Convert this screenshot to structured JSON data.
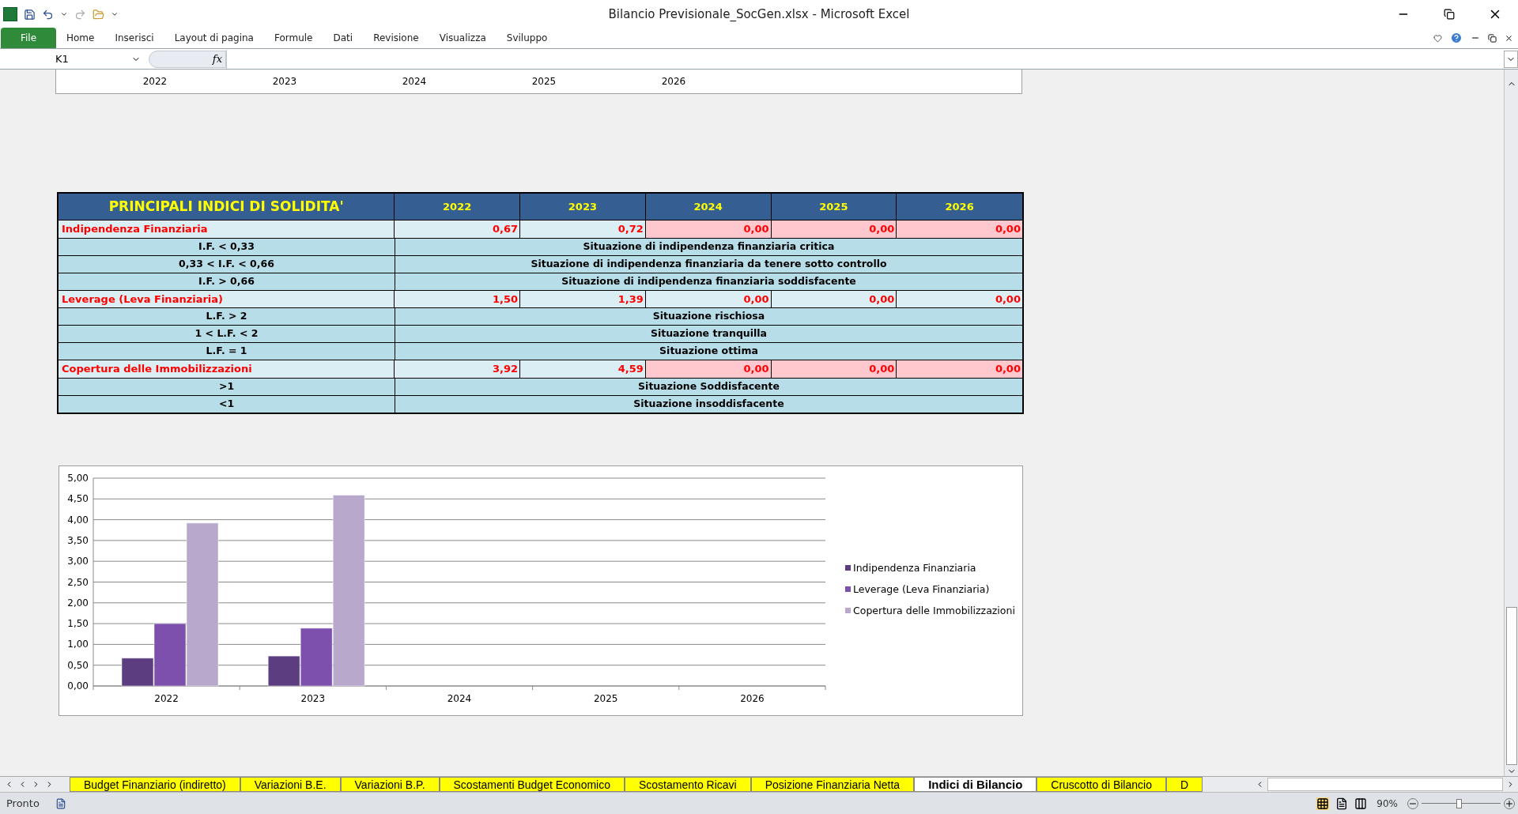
{
  "window": {
    "title": "Bilancio Previsionale_SocGen.xlsx  -  Microsoft Excel"
  },
  "ribbon": {
    "file_tab": "File",
    "tabs": [
      "Home",
      "Inserisci",
      "Layout di pagina",
      "Formule",
      "Dati",
      "Revisione",
      "Visualizza",
      "Sviluppo"
    ]
  },
  "formula_bar": {
    "name_box": "K1",
    "function_button": "fx"
  },
  "upper_chart_axis_labels": [
    "2022",
    "2023",
    "2024",
    "2025",
    "2026"
  ],
  "table": {
    "title": "PRINCIPALI INDICI DI SOLIDITA'",
    "years": [
      "2022",
      "2023",
      "2024",
      "2025",
      "2026"
    ],
    "rows": [
      {
        "kind": "indicator",
        "label": "Indipendenza Finanziaria",
        "values": [
          {
            "text": "0,67",
            "highlighted": false
          },
          {
            "text": "0,72",
            "highlighted": false
          },
          {
            "text": "0,00",
            "highlighted": true
          },
          {
            "text": "0,00",
            "highlighted": true
          },
          {
            "text": "0,00",
            "highlighted": true
          }
        ]
      },
      {
        "kind": "threshold",
        "label": "I.F. < 0,33",
        "description": "Situazione di indipendenza finanziaria critica"
      },
      {
        "kind": "threshold",
        "label": "0,33 < I.F. < 0,66",
        "description": "Situazione di indipendenza finanziaria da tenere sotto controllo"
      },
      {
        "kind": "threshold",
        "label": "I.F. > 0,66",
        "description": "Situazione di indipendenza finanziaria soddisfacente"
      },
      {
        "kind": "indicator",
        "label": "Leverage (Leva Finanziaria)",
        "values": [
          {
            "text": "1,50",
            "highlighted": false
          },
          {
            "text": "1,39",
            "highlighted": false
          },
          {
            "text": "0,00",
            "highlighted": false
          },
          {
            "text": "0,00",
            "highlighted": false
          },
          {
            "text": "0,00",
            "highlighted": false
          }
        ]
      },
      {
        "kind": "threshold",
        "label": "L.F. > 2",
        "description": "Situazione rischiosa"
      },
      {
        "kind": "threshold",
        "label": "1 < L.F. < 2",
        "description": "Situazione tranquilla"
      },
      {
        "kind": "threshold",
        "label": "L.F. = 1",
        "description": "Situazione ottima"
      },
      {
        "kind": "indicator",
        "label": "Copertura delle Immobilizzazioni",
        "values": [
          {
            "text": "3,92",
            "highlighted": false
          },
          {
            "text": "4,59",
            "highlighted": false
          },
          {
            "text": "0,00",
            "highlighted": true
          },
          {
            "text": "0,00",
            "highlighted": true
          },
          {
            "text": "0,00",
            "highlighted": true
          }
        ]
      },
      {
        "kind": "threshold",
        "label": ">1",
        "description": "Situazione Soddisfacente"
      },
      {
        "kind": "threshold",
        "label": "<1",
        "description": "Situazione insoddisfacente"
      }
    ]
  },
  "chart": {
    "chart_data": {
      "type": "bar",
      "categories": [
        "2022",
        "2023",
        "2024",
        "2025",
        "2026"
      ],
      "series": [
        {
          "name": "Indipendenza Finanziaria",
          "color": "#5b3d80",
          "values": [
            0.67,
            0.72,
            0,
            0,
            0
          ]
        },
        {
          "name": "Leverage (Leva Finanziaria)",
          "color": "#7c50ac",
          "values": [
            1.5,
            1.39,
            0,
            0,
            0
          ]
        },
        {
          "name": "Copertura delle Immobilizzazioni",
          "color": "#b7a8cc",
          "values": [
            3.92,
            4.59,
            0,
            0,
            0
          ]
        }
      ],
      "ylim": [
        0,
        5
      ],
      "grid": true,
      "legend": true,
      "yticks": [
        {
          "value": 0,
          "label": "0,00"
        },
        {
          "value": 0.5,
          "label": "0,50"
        },
        {
          "value": 1,
          "label": "1,00"
        },
        {
          "value": 1.5,
          "label": "1,50"
        },
        {
          "value": 2,
          "label": "2,00"
        },
        {
          "value": 2.5,
          "label": "2,50"
        },
        {
          "value": 3,
          "label": "3,00"
        },
        {
          "value": 3.5,
          "label": "3,50"
        },
        {
          "value": 4,
          "label": "4,00"
        },
        {
          "value": 4.5,
          "label": "4,50"
        },
        {
          "value": 5,
          "label": "5,00"
        }
      ]
    }
  },
  "sheet_tabs": [
    {
      "label": "Budget Finanziario (indiretto)",
      "selected": false
    },
    {
      "label": "Variazioni B.E.",
      "selected": false
    },
    {
      "label": "Variazioni B.P.",
      "selected": false
    },
    {
      "label": "Scostamenti Budget Economico",
      "selected": false
    },
    {
      "label": "Scostamento Ricavi",
      "selected": false
    },
    {
      "label": "Posizione Finanziaria Netta",
      "selected": false
    },
    {
      "label": "Indici di Bilancio",
      "selected": true
    },
    {
      "label": "Cruscotto di Bilancio",
      "selected": false
    },
    {
      "label": "D",
      "selected": false
    }
  ],
  "status_bar": {
    "status": "Pronto",
    "zoom": "90%",
    "zoom_slider": {
      "level": 0.47
    }
  }
}
